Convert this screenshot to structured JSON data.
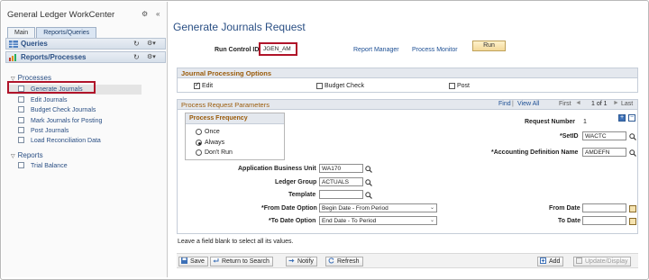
{
  "workcenter": {
    "title": "General Ledger WorkCenter",
    "tabs": [
      {
        "label": "Main"
      },
      {
        "label": "Reports/Queries"
      }
    ],
    "panes": {
      "queries": "Queries",
      "reports_processes": "Reports/Processes"
    },
    "processes": {
      "heading": "Processes",
      "items": [
        {
          "label": "Generate Journals"
        },
        {
          "label": "Edit Journals"
        },
        {
          "label": "Budget Check Journals"
        },
        {
          "label": "Mark Journals for Posting"
        },
        {
          "label": "Post Journals"
        },
        {
          "label": "Load Reconciliation Data"
        }
      ]
    },
    "reports": {
      "heading": "Reports",
      "items": [
        {
          "label": "Trial Balance"
        }
      ]
    }
  },
  "page": {
    "title": "Generate Journals Request",
    "run_control_label": "Run Control ID",
    "run_control_value": "JGEN_AM",
    "report_manager": "Report Manager",
    "process_monitor": "Process Monitor",
    "run_button": "Run"
  },
  "journal_options": {
    "heading": "Journal Processing Options",
    "edit": {
      "label": "Edit",
      "checked": true
    },
    "budget_check": {
      "label": "Budget Check",
      "checked": false
    },
    "post": {
      "label": "Post",
      "checked": false
    }
  },
  "params": {
    "heading": "Process Request Parameters",
    "find": "Find",
    "view_all": "View All",
    "separator": "|",
    "first": "First",
    "pager": "1 of 1",
    "last": "Last",
    "frequency_heading": "Process Frequency",
    "frequency_options": [
      {
        "label": "Once",
        "selected": false
      },
      {
        "label": "Always",
        "selected": true
      },
      {
        "label": "Don't Run",
        "selected": false
      }
    ],
    "request_number_label": "Request Number",
    "request_number_value": "1",
    "setid_label": "*SetID",
    "setid_value": "WACTC",
    "accounting_def_label": "*Accounting Definition Name",
    "accounting_def_value": "AMDEFN",
    "business_unit_label": "Application Business Unit",
    "business_unit_value": "WA170",
    "ledger_group_label": "Ledger Group",
    "ledger_group_value": "ACTUALS",
    "template_label": "Template",
    "template_value": "",
    "from_date_option_label": "*From Date Option",
    "from_date_option_value": "Begin Date - From Period",
    "to_date_option_label": "*To Date Option",
    "to_date_option_value": "End Date - To Period",
    "from_date_label": "From Date",
    "from_date_value": "",
    "to_date_label": "To Date",
    "to_date_value": "",
    "add_row": "+",
    "delete_row": "−"
  },
  "footer_note": "Leave a field blank to select all its values.",
  "toolbar": {
    "save": "Save",
    "return_to_search": "Return to Search",
    "notify": "Notify",
    "refresh": "Refresh",
    "add": "Add",
    "update_display": "Update/Display"
  },
  "colors": {
    "link": "#1d4f94",
    "highlight": "#b0142a",
    "group_heading": "#9a5b0a"
  }
}
